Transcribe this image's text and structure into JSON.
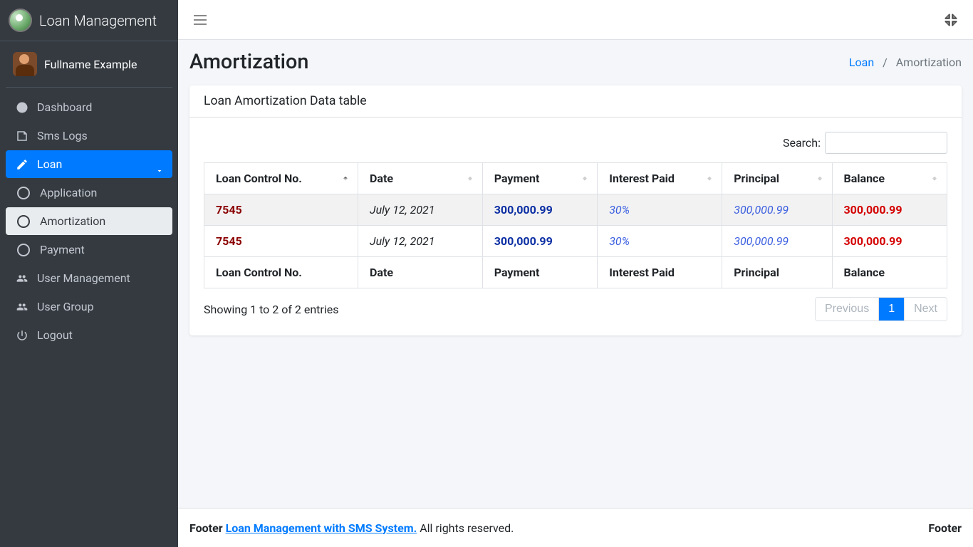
{
  "brand": {
    "title": "Loan Management"
  },
  "user": {
    "fullname": "Fullname Example"
  },
  "sidebar": {
    "items": [
      {
        "label": "Dashboard",
        "icon": "dashboard-icon"
      },
      {
        "label": "Sms Logs",
        "icon": "note-icon"
      },
      {
        "label": "Loan",
        "icon": "edit-icon",
        "open": true,
        "sub": [
          {
            "label": "Application"
          },
          {
            "label": "Amortization",
            "active": true
          },
          {
            "label": "Payment"
          }
        ]
      },
      {
        "label": "User Management",
        "icon": "users-icon"
      },
      {
        "label": "User Group",
        "icon": "users-icon"
      },
      {
        "label": "Logout",
        "icon": "power-icon"
      }
    ]
  },
  "page": {
    "title": "Amortization",
    "breadcrumb": {
      "root": "Loan",
      "current": "Amortization"
    }
  },
  "card": {
    "title": "Loan Amortization Data table"
  },
  "datatable": {
    "search_label": "Search:",
    "columns": [
      "Loan Control No.",
      "Date",
      "Payment",
      "Interest Paid",
      "Principal",
      "Balance"
    ],
    "rows": [
      {
        "control": "7545",
        "date": "July 12, 2021",
        "payment": "300,000.99",
        "interest": "30%",
        "principal": "300,000.99",
        "balance": "300,000.99"
      },
      {
        "control": "7545",
        "date": "July 12, 2021",
        "payment": "300,000.99",
        "interest": "30%",
        "principal": "300,000.99",
        "balance": "300,000.99"
      }
    ],
    "info": "Showing 1 to 2 of 2 entries",
    "pagination": {
      "previous": "Previous",
      "pages": [
        "1"
      ],
      "next": "Next",
      "active": "1"
    }
  },
  "footer": {
    "prefix": "Footer ",
    "app": "Loan Management with SMS System.",
    "suffix": " All rights reserved.",
    "right": "Footer"
  }
}
